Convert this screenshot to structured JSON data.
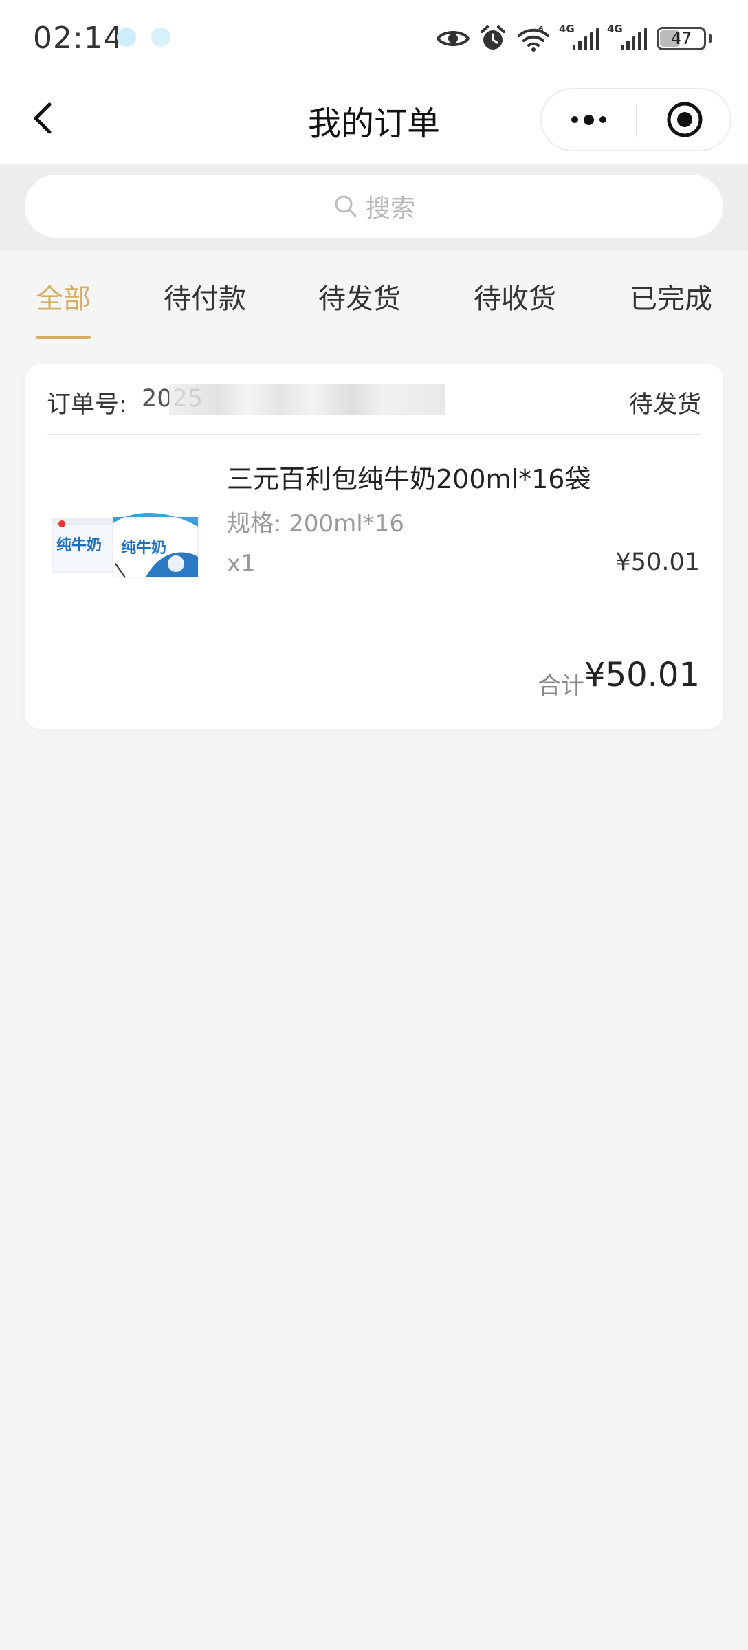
{
  "status_bar": {
    "time": "02:14",
    "signal_1_label": "4G",
    "signal_2_label": "4G",
    "battery": "47",
    "icons": [
      "eye-icon",
      "alarm-icon",
      "wifi-icon",
      "signal-icon",
      "signal-icon",
      "battery-icon"
    ]
  },
  "nav": {
    "title": "我的订单",
    "icons": [
      "back-icon",
      "more-icon",
      "target-icon"
    ]
  },
  "search": {
    "placeholder": "搜索",
    "icon": "search-icon"
  },
  "tabs": [
    {
      "label": "全部",
      "active": true
    },
    {
      "label": "待付款",
      "active": false
    },
    {
      "label": "待发货",
      "active": false
    },
    {
      "label": "待收货",
      "active": false
    },
    {
      "label": "已完成",
      "active": false
    }
  ],
  "order": {
    "number_label": "订单号:",
    "number_visible": "2025",
    "status": "待发货",
    "product": {
      "name": "三元百利包纯牛奶200ml*16袋",
      "spec": "规格: 200ml*16",
      "quantity": "x1",
      "price": "¥50.01",
      "image_text": "纯牛奶"
    },
    "total_label": "合计",
    "total_value": "¥50.01"
  },
  "colors": {
    "accent": "#d6ad62",
    "page_bg": "#f5f5f5",
    "search_bg": "#ededed"
  }
}
